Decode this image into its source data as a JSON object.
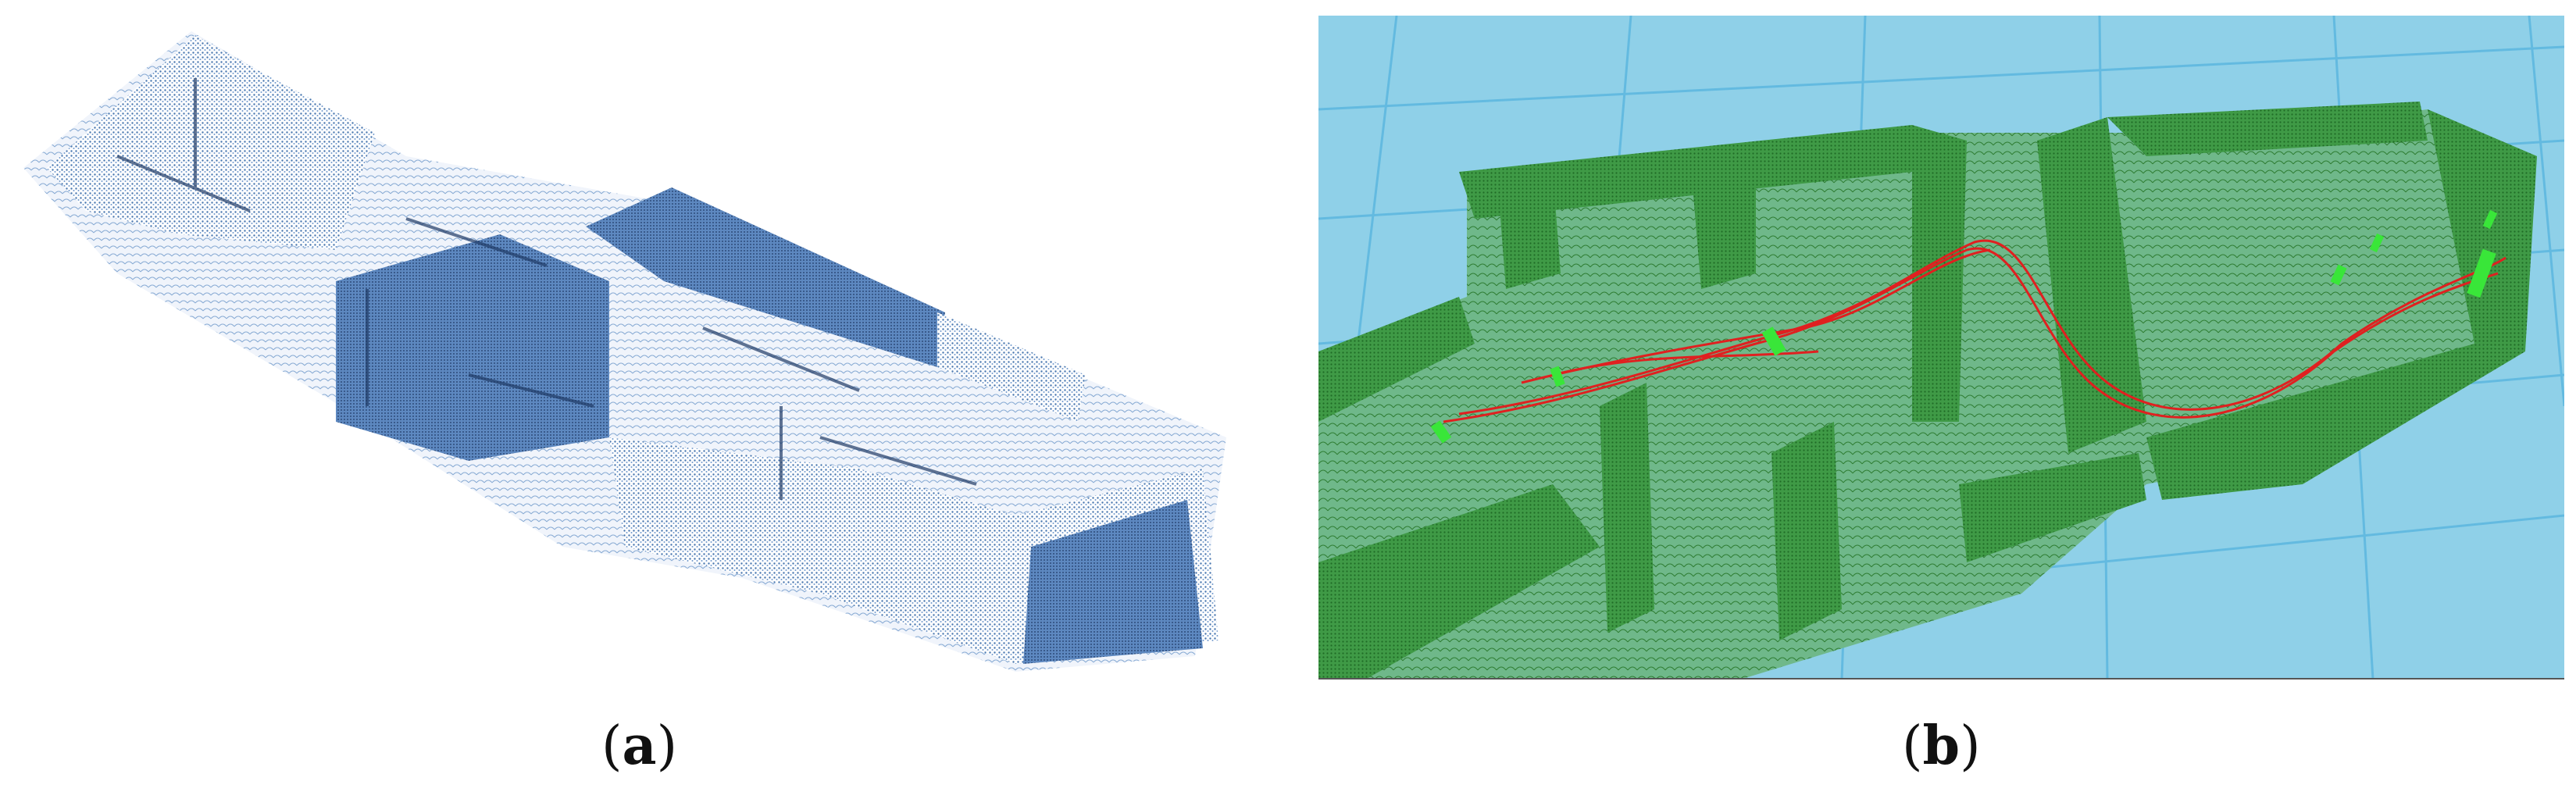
{
  "figure": {
    "panel_a": {
      "caption_open": "(",
      "caption_letter": "a",
      "caption_close": ")",
      "point_color": "#4a78b0",
      "point_dark": "#1f3a66"
    },
    "panel_b": {
      "caption_open": "(",
      "caption_letter": "b",
      "caption_close": ")",
      "background_color": "#8fd0e8",
      "grid_color": "#5fb8e0",
      "point_color": "#2e7d32",
      "trajectory_color": "#e02020",
      "marker_color": "#39e639"
    }
  }
}
